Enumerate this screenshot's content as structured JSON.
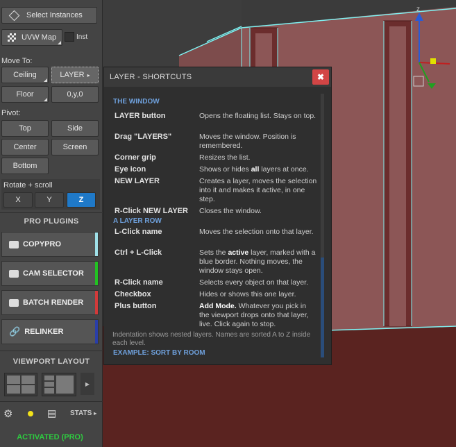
{
  "panel": {
    "select_instances": "Select Instances",
    "uvw_map": "UVW Map",
    "inst_label": "Inst",
    "move_to": "Move To:",
    "ceiling": "Ceiling",
    "layer": "LAYER",
    "floor": "Floor",
    "zero_pos": "0,y,0",
    "pivot": "Pivot:",
    "top": "Top",
    "side": "Side",
    "center": "Center",
    "screen": "Screen",
    "bottom": "Bottom",
    "rotate_scroll": "Rotate + scroll",
    "axis_x": "X",
    "axis_y": "Y",
    "axis_z": "Z",
    "pro_plugins": "PRO PLUGINS",
    "plugins": [
      {
        "label": "COPYPRO",
        "color": "#9fe0e8"
      },
      {
        "label": "CAM SELECTOR",
        "color": "#22c222"
      },
      {
        "label": "BATCH RENDER",
        "color": "#d23a3a"
      },
      {
        "label": "RELINKER",
        "color": "#2a3ea8"
      }
    ],
    "viewport_layout": "VIEWPORT LAYOUT",
    "stats": "STATS",
    "activated": "ACTIVATED (PRO)"
  },
  "popup": {
    "title": "LAYER - SHORTCUTS",
    "close_glyph": "✖",
    "sec_window": "THE WINDOW",
    "rows_window": [
      {
        "k": "LAYER button",
        "v": "Opens the floating list. Stays on top."
      },
      {
        "k": "Drag \"LAYERS\"",
        "v": "Moves the window. Position is remembered."
      },
      {
        "k": "Corner grip",
        "v": "Resizes the list."
      },
      {
        "k": "Eye icon",
        "v_pre": "Shows or hides ",
        "v_bold": "all",
        "v_post": " layers at once."
      },
      {
        "k": "NEW LAYER",
        "v": "Creates a layer, moves the selection into it and makes it active, in one step."
      },
      {
        "k": "R-Click NEW LAYER",
        "v": "Closes the window."
      }
    ],
    "sec_row": "A LAYER ROW",
    "rows_row": [
      {
        "k": "L-Click name",
        "v": "Moves the selection onto that layer."
      },
      {
        "k": "Ctrl + L-Click",
        "v_pre": "Sets the ",
        "v_bold": "active",
        "v_post": " layer, marked with a blue border. Nothing moves, the window stays open."
      },
      {
        "k": "R-Click name",
        "v": "Selects every object on that layer."
      },
      {
        "k": "Checkbox",
        "v": "Hides or shows this one layer."
      },
      {
        "k": "Plus button",
        "v_bold": "Add Mode.",
        "v_post": " Whatever you pick in the viewport drops onto that layer, live. Click again to stop."
      }
    ],
    "note": "Indentation shows nested layers. Names are sorted A to Z inside each level.",
    "sec_example": "EXAMPLE: SORT BY ROOM"
  },
  "colors": {
    "accent_blue": "#1f79c8",
    "active_green": "#2ecc40",
    "wall": "#8c5656",
    "floor": "#5a2320",
    "wire": "#7ff3f3"
  },
  "gizmo": {
    "axis_label": "z"
  }
}
